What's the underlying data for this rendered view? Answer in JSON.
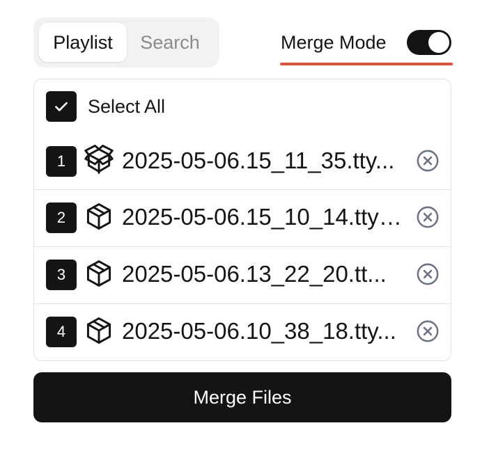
{
  "tabs": {
    "playlist_label": "Playlist",
    "search_label": "Search",
    "active": "Playlist"
  },
  "merge_mode": {
    "label": "Merge Mode",
    "enabled": true,
    "underline_color": "#e0533a"
  },
  "list": {
    "select_all_label": "Select All",
    "select_all_checked": true,
    "items": [
      {
        "number": "1",
        "icon": "package-open-icon",
        "name": "2025-05-06.15_11_35.tty..."
      },
      {
        "number": "2",
        "icon": "package-icon",
        "name": "2025-05-06.15_10_14.ttyr..."
      },
      {
        "number": "3",
        "icon": "package-icon",
        "name": "2025-05-06.13_22_20.tt..."
      },
      {
        "number": "4",
        "icon": "package-icon",
        "name": "2025-05-06.10_38_18.tty..."
      }
    ]
  },
  "merge_button_label": "Merge Files"
}
